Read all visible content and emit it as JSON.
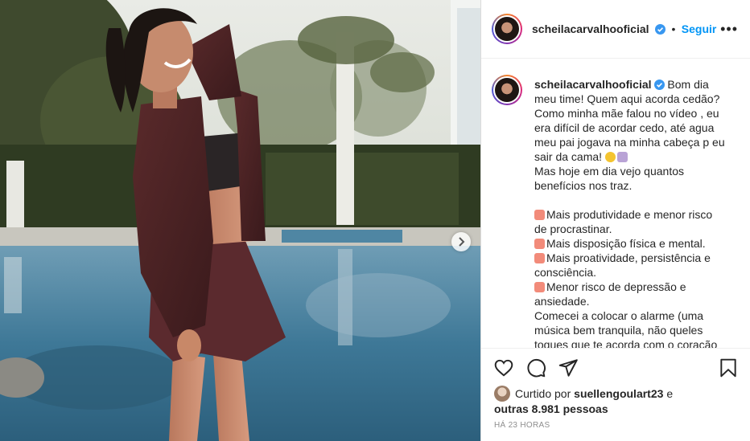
{
  "post": {
    "username": "scheilacarvalhooficial",
    "follow_label": "Seguir",
    "more_label": "•••",
    "separator": "•"
  },
  "caption": {
    "username": "scheilacarvalhooficial",
    "lines": [
      "Bom dia meu time! Quem aqui acorda cedão?",
      "Como minha mãe falou no vídeo , eu era difícil de acordar cedo, até agua meu pai jogava na minha cabeça p eu sair da cama!",
      "Mas hoje em dia vejo quantos benefícios nos traz.",
      "Mais produtividade e menor risco de procrastinar.",
      "Mais disposição física e mental.",
      "Mais proatividade, persistência e consciência.",
      "Menor risco de depressão e ansiedade.",
      "Comecei a colocar o alarme (uma música bem tranquila, não queles toques que te acorda com o coração"
    ]
  },
  "likes": {
    "prefix": "Curtido por",
    "first_user": "suellengoulart23",
    "conjunction": "e",
    "others": "outras 8.981 pessoas"
  },
  "timestamp": "HÁ 23 HORAS",
  "icons": {
    "verified": "verified-badge-icon",
    "like": "heart-icon",
    "comment": "comment-icon",
    "share": "paper-plane-icon",
    "save": "bookmark-icon",
    "next": "chevron-right-icon",
    "alarm": "alarm-clock-icon"
  },
  "colors": {
    "accent": "#0095f6",
    "text": "#262626",
    "muted": "#8e8e8e",
    "verified": "#3897f0"
  }
}
